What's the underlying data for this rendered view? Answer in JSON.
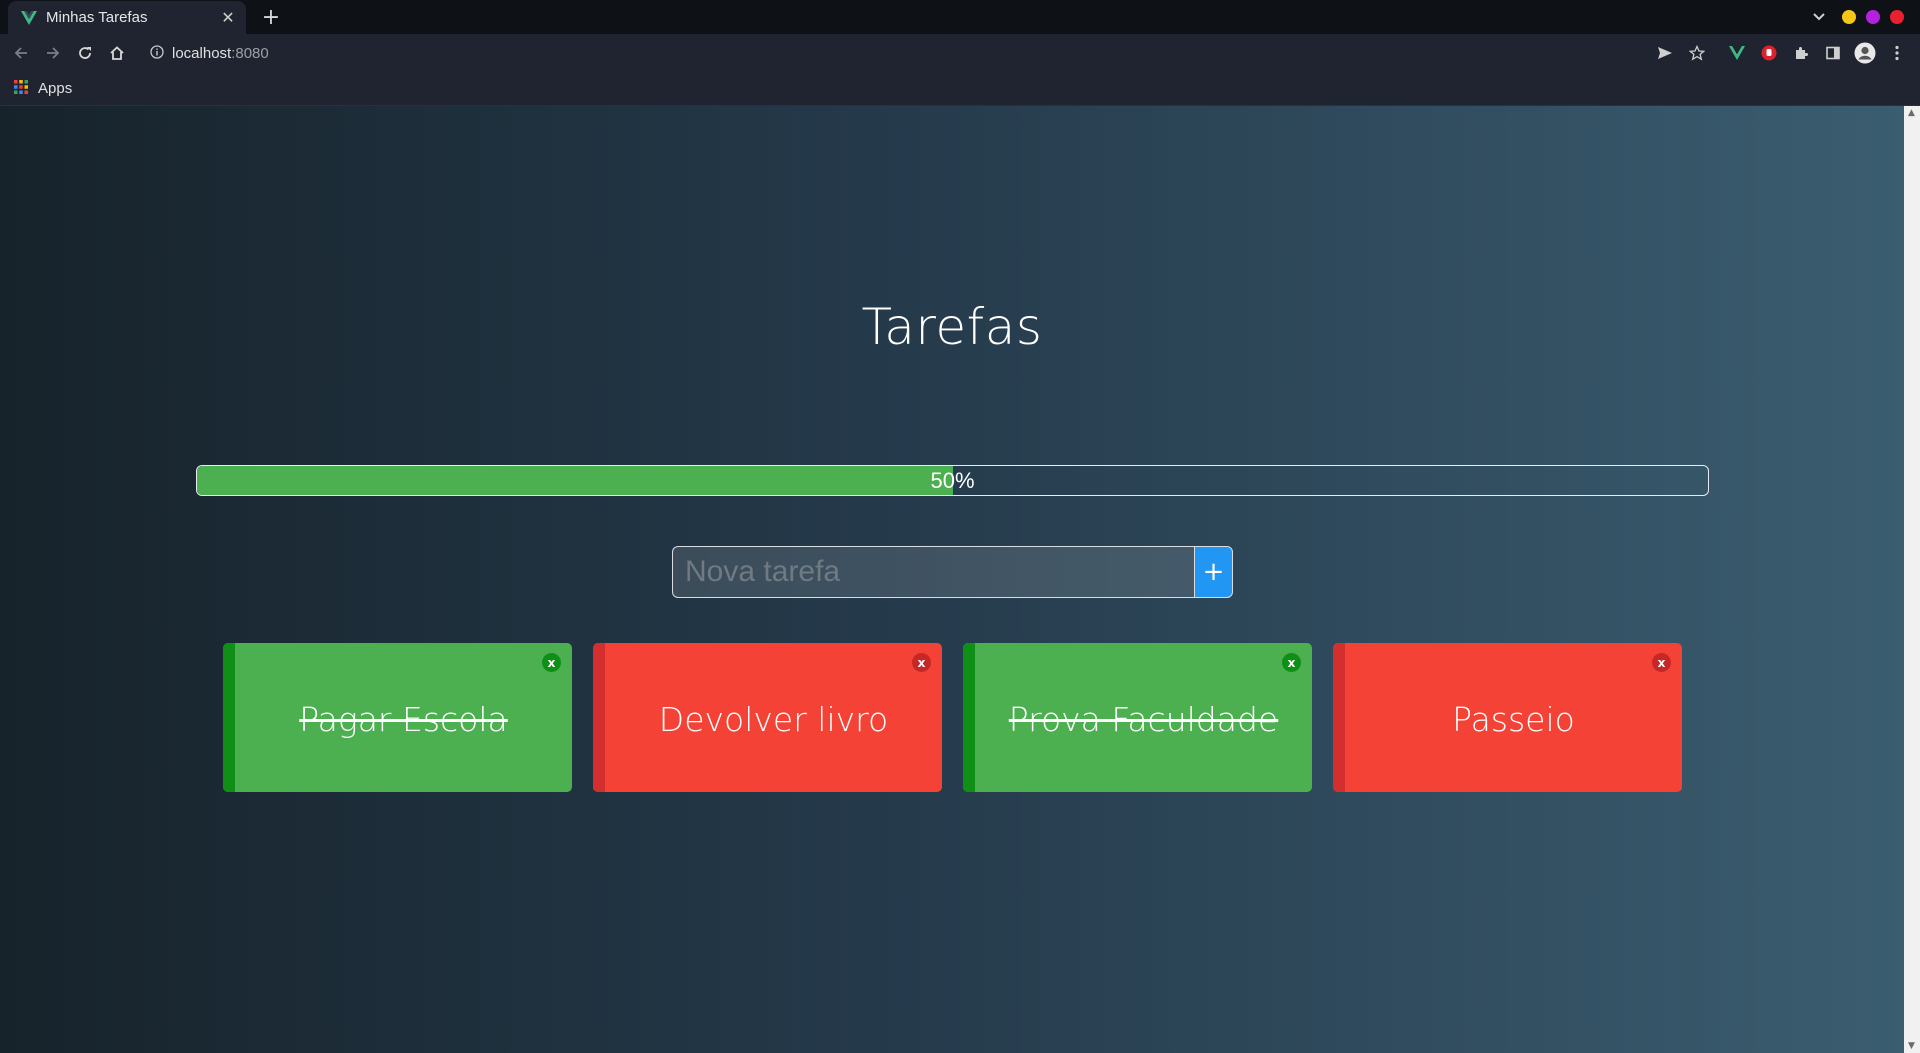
{
  "browser": {
    "tab_title": "Minhas Tarefas",
    "url_host": "localhost",
    "url_port": ":8080",
    "bookmark_label": "Apps"
  },
  "app": {
    "title": "Tarefas",
    "progress": {
      "percent": 50,
      "label": "50%"
    },
    "new_task_placeholder": "Nova tarefa",
    "add_button_label": "+",
    "tasks": [
      {
        "label": "Pagar Escola",
        "done": true,
        "delete_label": "x"
      },
      {
        "label": "Devolver livro",
        "done": false,
        "delete_label": "x"
      },
      {
        "label": "Prova Faculdade",
        "done": true,
        "delete_label": "x"
      },
      {
        "label": "Passeio",
        "done": false,
        "delete_label": "x"
      }
    ]
  },
  "colors": {
    "done": "#4caf50",
    "pending": "#f44336",
    "accent": "#2196f3"
  }
}
